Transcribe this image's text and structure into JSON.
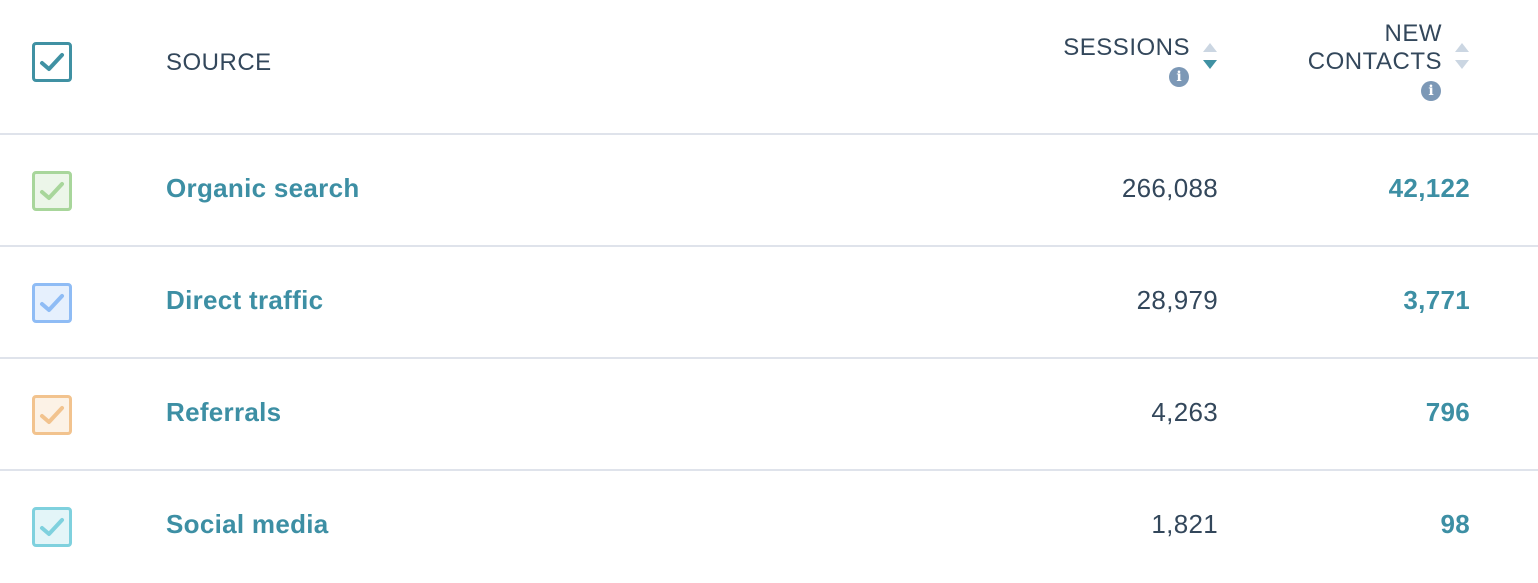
{
  "header": {
    "source_label": "SOURCE",
    "sessions_label": "SESSIONS",
    "new_contacts_line1": "NEW",
    "new_contacts_line2": "CONTACTS",
    "info_glyph": "i",
    "sort_column": "sessions",
    "sort_direction": "descending"
  },
  "rows": [
    {
      "source": "Organic search",
      "sessions": "266,088",
      "new_contacts": "42,122",
      "checkbox_color": "#a8d69b",
      "checked": true
    },
    {
      "source": "Direct traffic",
      "sessions": "28,979",
      "new_contacts": "3,771",
      "checkbox_color": "#8fbcf5",
      "checked": true
    },
    {
      "source": "Referrals",
      "sessions": "4,263",
      "new_contacts": "796",
      "checkbox_color": "#f2c38e",
      "checked": true
    },
    {
      "source": "Social media",
      "sessions": "1,821",
      "new_contacts": "98",
      "checkbox_color": "#7fd1de",
      "checked": true
    }
  ],
  "colors": {
    "link": "#3d8fa4",
    "text": "#33475b",
    "divider": "#dfe3eb",
    "header_checkbox": "#4091a3",
    "sort_active": "#4091a3",
    "sort_inactive": "#cbd6e2",
    "info_icon": "#7c98b6"
  },
  "icons": {
    "checkbox": "checkmark-icon",
    "info": "info-icon",
    "sort": "sort-arrows-icon"
  }
}
